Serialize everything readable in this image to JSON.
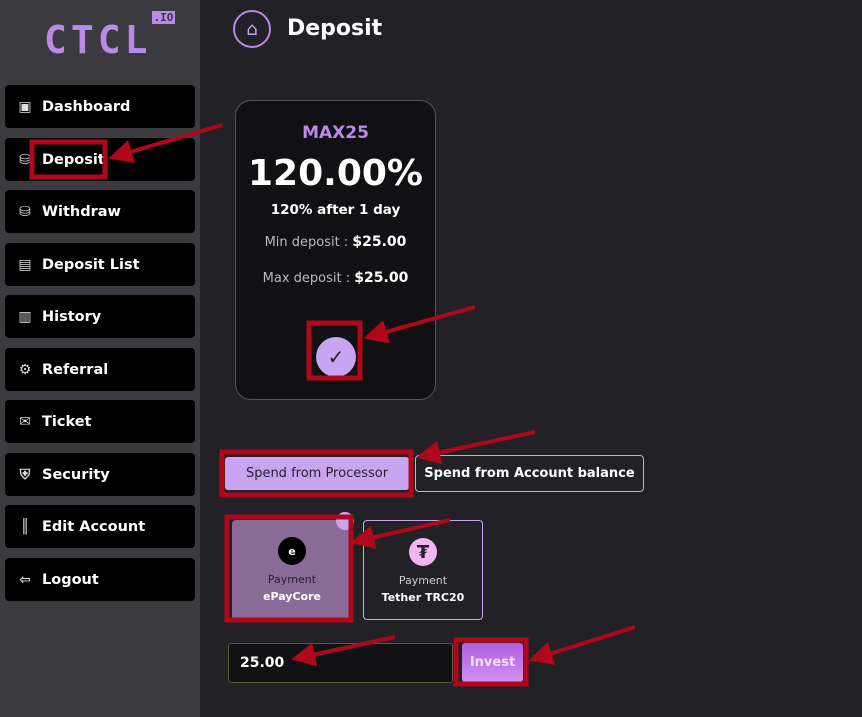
{
  "brand": {
    "logo": "CTCL",
    "logo_suffix": ".IO"
  },
  "sidebar": {
    "items": [
      {
        "label": "Dashboard",
        "icon": "dashboard-icon"
      },
      {
        "label": "Deposit",
        "icon": "deposit-icon"
      },
      {
        "label": "Withdraw",
        "icon": "withdraw-icon"
      },
      {
        "label": "Deposit List",
        "icon": "bag-icon"
      },
      {
        "label": "History",
        "icon": "history-icon"
      },
      {
        "label": "Referral",
        "icon": "referral-icon"
      },
      {
        "label": "Ticket",
        "icon": "ticket-icon"
      },
      {
        "label": "Security",
        "icon": "shield-icon"
      },
      {
        "label": "Edit Account",
        "icon": "edit-icon"
      },
      {
        "label": "Logout",
        "icon": "logout-icon"
      }
    ]
  },
  "header": {
    "title": "Deposit"
  },
  "plan": {
    "name": "MAX25",
    "percent": "120.00%",
    "term": "120% after 1 day",
    "min_label": "Min deposit :",
    "min_value": "$25.00",
    "max_label": "Max deposit :",
    "max_value": "$25.00",
    "check": "✓"
  },
  "spend": {
    "processor": "Spend from Processor",
    "balance": "Spend from Account balance"
  },
  "methods": [
    {
      "label": "Payment",
      "name": "ePayCore"
    },
    {
      "label": "Payment",
      "name": "Tether TRC20"
    }
  ],
  "amount": {
    "value": "25.00"
  },
  "invest_label": "Invest",
  "colors": {
    "accent": "#b98ae8",
    "annotation": "#b0081a"
  }
}
